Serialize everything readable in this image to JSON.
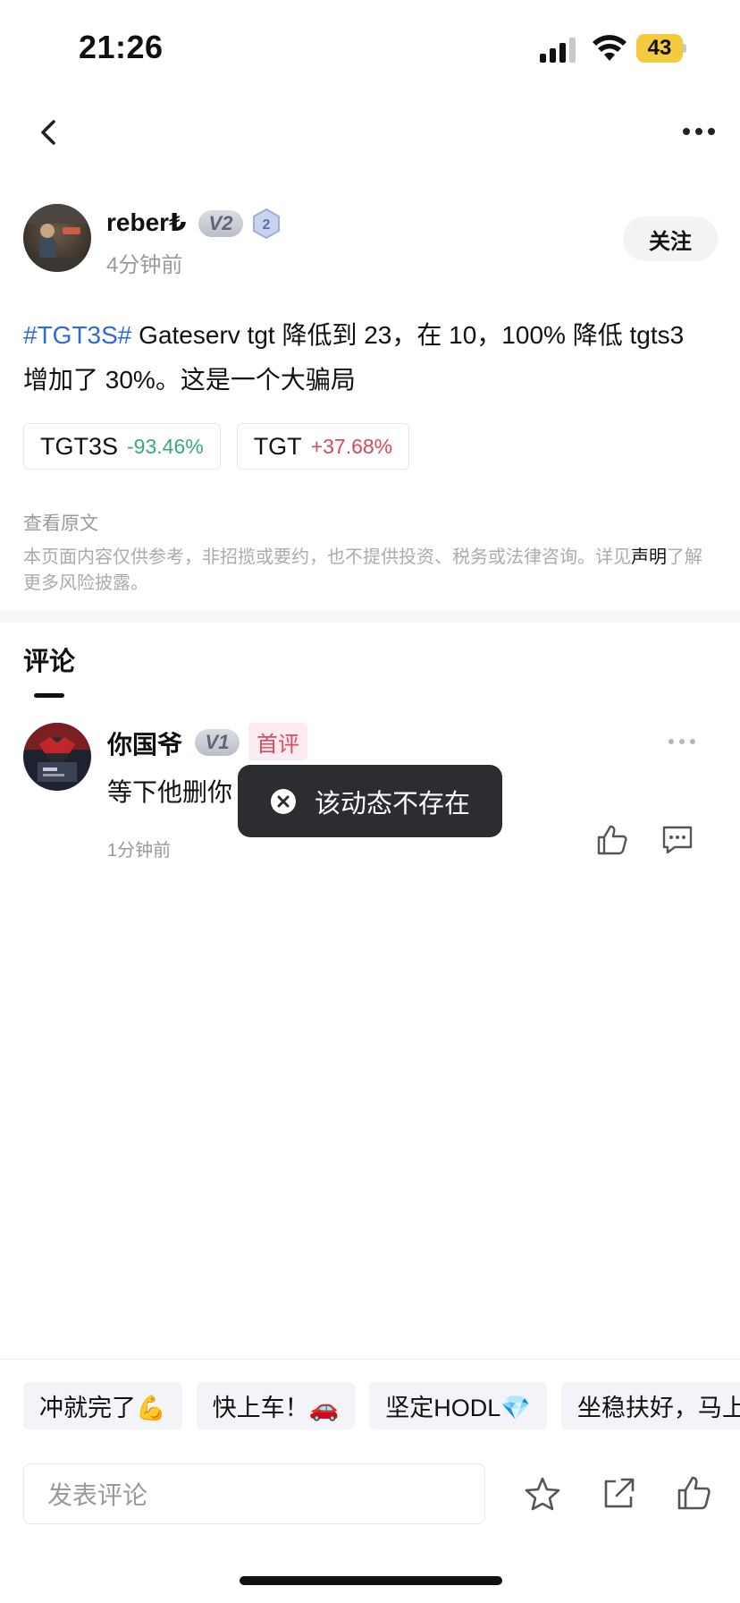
{
  "status_bar": {
    "time": "21:26",
    "battery": "43",
    "battery_color": "#f2cc3e"
  },
  "nav": {
    "back_icon": "chevron-left-icon",
    "more_icon": "more-horizontal-icon"
  },
  "author": {
    "name": "reber₺",
    "vip_badge": "V2",
    "level_badge": "2",
    "time": "4分钟前",
    "follow_label": "关注"
  },
  "post": {
    "hashtag": "#TGT3S#",
    "text": " Gateserv tgt 降低到 23，在 10，100% 降低 tgts3 增加了 30%。这是一个大骗局",
    "tickers": [
      {
        "symbol": "TGT3S",
        "change": "-93.46%",
        "direction": "down"
      },
      {
        "symbol": "TGT",
        "change": "+37.68%",
        "direction": "up"
      }
    ],
    "view_original": "查看原文",
    "disclaimer_prefix": "本页面内容仅供参考，非招揽或要约，也不提供投资、税务或法律咨询。详见",
    "disclaimer_link": "声明",
    "disclaimer_suffix": "了解更多风险披露。"
  },
  "comments_section": {
    "tab_label": "评论",
    "comments": [
      {
        "author": "你国爷",
        "vip_badge": "V1",
        "first_badge": "首评",
        "text": "等下他删你",
        "time": "1分钟前"
      }
    ]
  },
  "toast": {
    "text": "该动态不存在",
    "icon": "close-circle-icon"
  },
  "quick_replies": [
    "冲就完了💪",
    "快上车！🚗",
    "坚定HODL💎",
    "坐稳扶好，马上"
  ],
  "bottom_bar": {
    "input_placeholder": "发表评论",
    "icons": [
      "star-icon",
      "share-icon",
      "thumbs-up-icon"
    ]
  },
  "colors": {
    "hashtag": "#2c6bd8",
    "negative_change": "#3aaa72",
    "positive_change": "#d9475b",
    "toast_bg": "#2b2d31"
  }
}
